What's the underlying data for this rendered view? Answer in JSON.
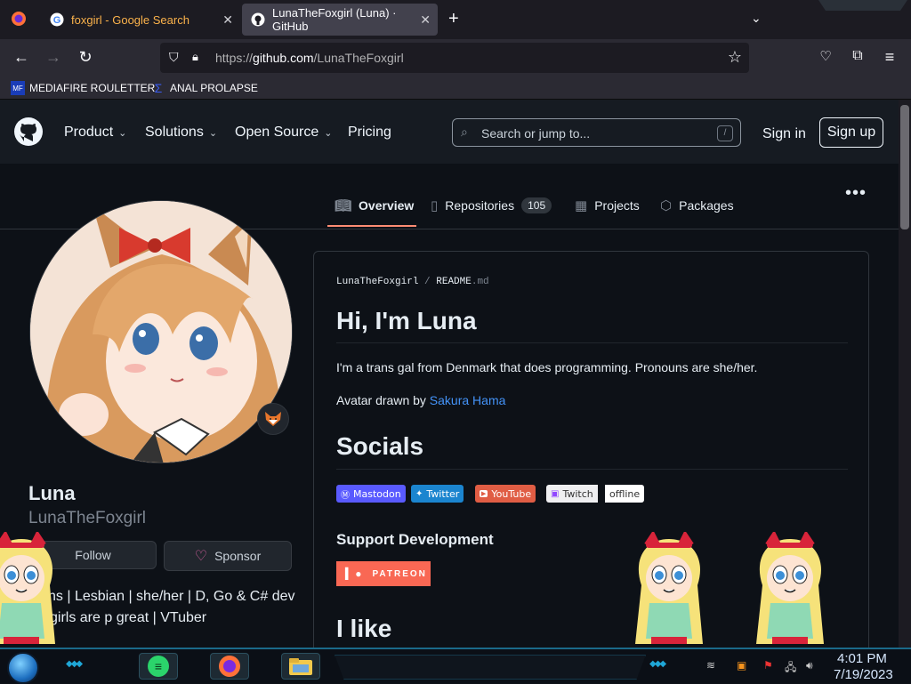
{
  "browser": {
    "tabs": [
      {
        "title": "foxgirl - Google Search",
        "favicon": "google-icon"
      },
      {
        "title": "LunaTheFoxgirl (Luna) · GitHub",
        "favicon": "github-icon",
        "active": true
      }
    ],
    "url_prefix": "https://",
    "url_domain": "github.com",
    "url_path": "/LunaTheFoxgirl",
    "bookmarks": [
      {
        "label": "MEDIAFIRE ROULETTER",
        "icon_text": "MF"
      },
      {
        "label": "ANAL PROLAPSE"
      }
    ]
  },
  "github_header": {
    "nav": [
      "Product",
      "Solutions",
      "Open Source",
      "Pricing"
    ],
    "search_placeholder": "Search or jump to...",
    "search_key": "/",
    "sign_in": "Sign in",
    "sign_up": "Sign up"
  },
  "profile_tabs": {
    "overview": "Overview",
    "repositories": "Repositories",
    "repo_count": "105",
    "projects": "Projects",
    "packages": "Packages"
  },
  "profile": {
    "display_name": "Luna",
    "username": "LunaTheFoxgirl",
    "follow": "Follow",
    "sponsor": "Sponsor",
    "bio_line1": "ns | Lesbian | she/her | D, Go & C# dev",
    "bio_line2": "xgirls are p great | VTuber"
  },
  "readme": {
    "path_user": "LunaTheFoxgirl",
    "path_sep": "/",
    "path_file": "README",
    "path_ext": ".md",
    "heading1": "Hi, I'm Luna",
    "intro": "I'm a trans gal from Denmark that does programming. Pronouns are she/her.",
    "avatar_credit_prefix": "Avatar drawn by ",
    "avatar_credit_link": "Sakura Hama",
    "heading_socials": "Socials",
    "badges": {
      "mastodon": "Mastodon",
      "twitter": "Twitter",
      "youtube": "YouTube",
      "twitch": "Twitch",
      "twitch_status": "offline"
    },
    "heading_support": "Support Development",
    "patreon": "PATREON",
    "heading_ilike": "I like"
  },
  "taskbar": {
    "time": "4:01 PM",
    "date": "7/19/2023"
  },
  "colors": {
    "accent_orange": "#fd8c73",
    "link_blue": "#4493f8",
    "patreon": "#f96854",
    "sponsor_pink": "#db61a2"
  }
}
